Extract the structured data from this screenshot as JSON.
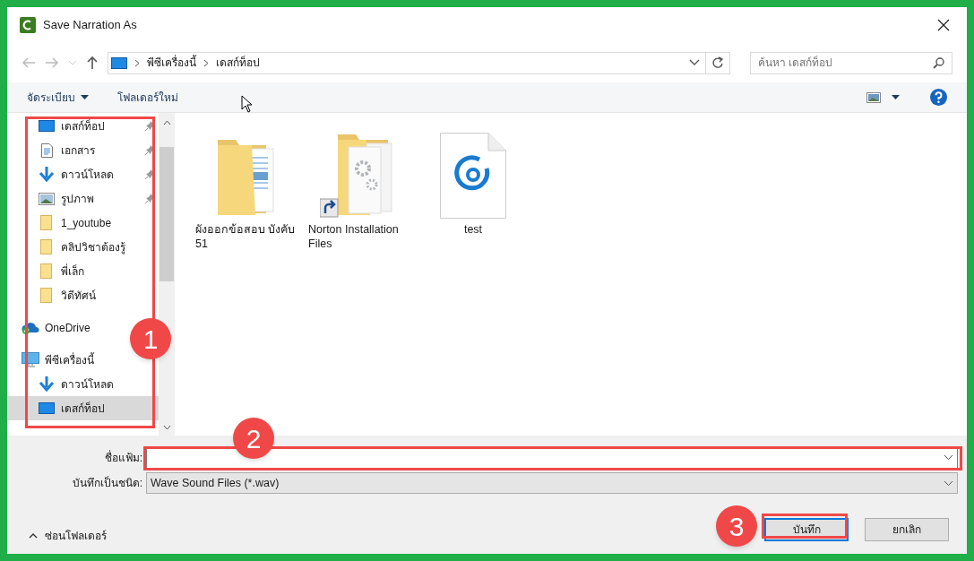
{
  "window": {
    "title": "Save Narration As"
  },
  "address_bar": {
    "path": [
      "พีซีเครื่องนี้",
      "เดสก์ท็อป"
    ]
  },
  "search": {
    "placeholder": "ค้นหา เดสก์ท็อป"
  },
  "toolbar": {
    "organize": "จัดระเบียบ",
    "new_folder": "โฟลเดอร์ใหม่"
  },
  "sidebar": {
    "items": [
      {
        "label": "เดสก์ท็อป",
        "kind": "desktop",
        "pinned": true,
        "selected": false
      },
      {
        "label": "เอกสาร",
        "kind": "document",
        "pinned": true,
        "selected": false
      },
      {
        "label": "ดาวน์โหลด",
        "kind": "download",
        "pinned": true,
        "selected": false
      },
      {
        "label": "รูปภาพ",
        "kind": "pictures",
        "pinned": true,
        "selected": false
      },
      {
        "label": "1_youtube",
        "kind": "folder",
        "pinned": false,
        "selected": false
      },
      {
        "label": "คลิปวิชาต้องรู้",
        "kind": "folder",
        "pinned": false,
        "selected": false
      },
      {
        "label": "พี่เล็ก",
        "kind": "folder",
        "pinned": false,
        "selected": false
      },
      {
        "label": "วิดีทัศน์",
        "kind": "folder",
        "pinned": false,
        "selected": false
      },
      {
        "label": "OneDrive",
        "kind": "onedrive",
        "pinned": false,
        "selected": false
      },
      {
        "label": "พีซีเครื่องนี้",
        "kind": "pc",
        "pinned": false,
        "selected": false,
        "children": [
          {
            "label": "ดาวน์โหลด",
            "kind": "download",
            "pinned": false,
            "selected": false
          },
          {
            "label": "เดสก์ท็อป",
            "kind": "desktop",
            "pinned": false,
            "selected": true
          }
        ]
      }
    ]
  },
  "files": [
    {
      "name": "ผังออกข้อสอบ บังคับ 51",
      "kind": "folder-documents"
    },
    {
      "name": "Norton Installation Files",
      "kind": "folder-shortcut"
    },
    {
      "name": "test",
      "kind": "audio-file"
    }
  ],
  "form": {
    "filename_label": "ชื่อแฟ้ม:",
    "type_label": "บันทึกเป็นชนิด:",
    "type_value": "Wave Sound Files (*.wav)"
  },
  "hide_folders": "ซ่อนโฟลเดอร์",
  "buttons": [
    {
      "label": "บันทึก",
      "kind": "primary"
    },
    {
      "label": "ยกเลิก",
      "kind": "secondary"
    }
  ],
  "annotations": [
    {
      "label": "1"
    },
    {
      "label": "2"
    },
    {
      "label": "3"
    }
  ]
}
